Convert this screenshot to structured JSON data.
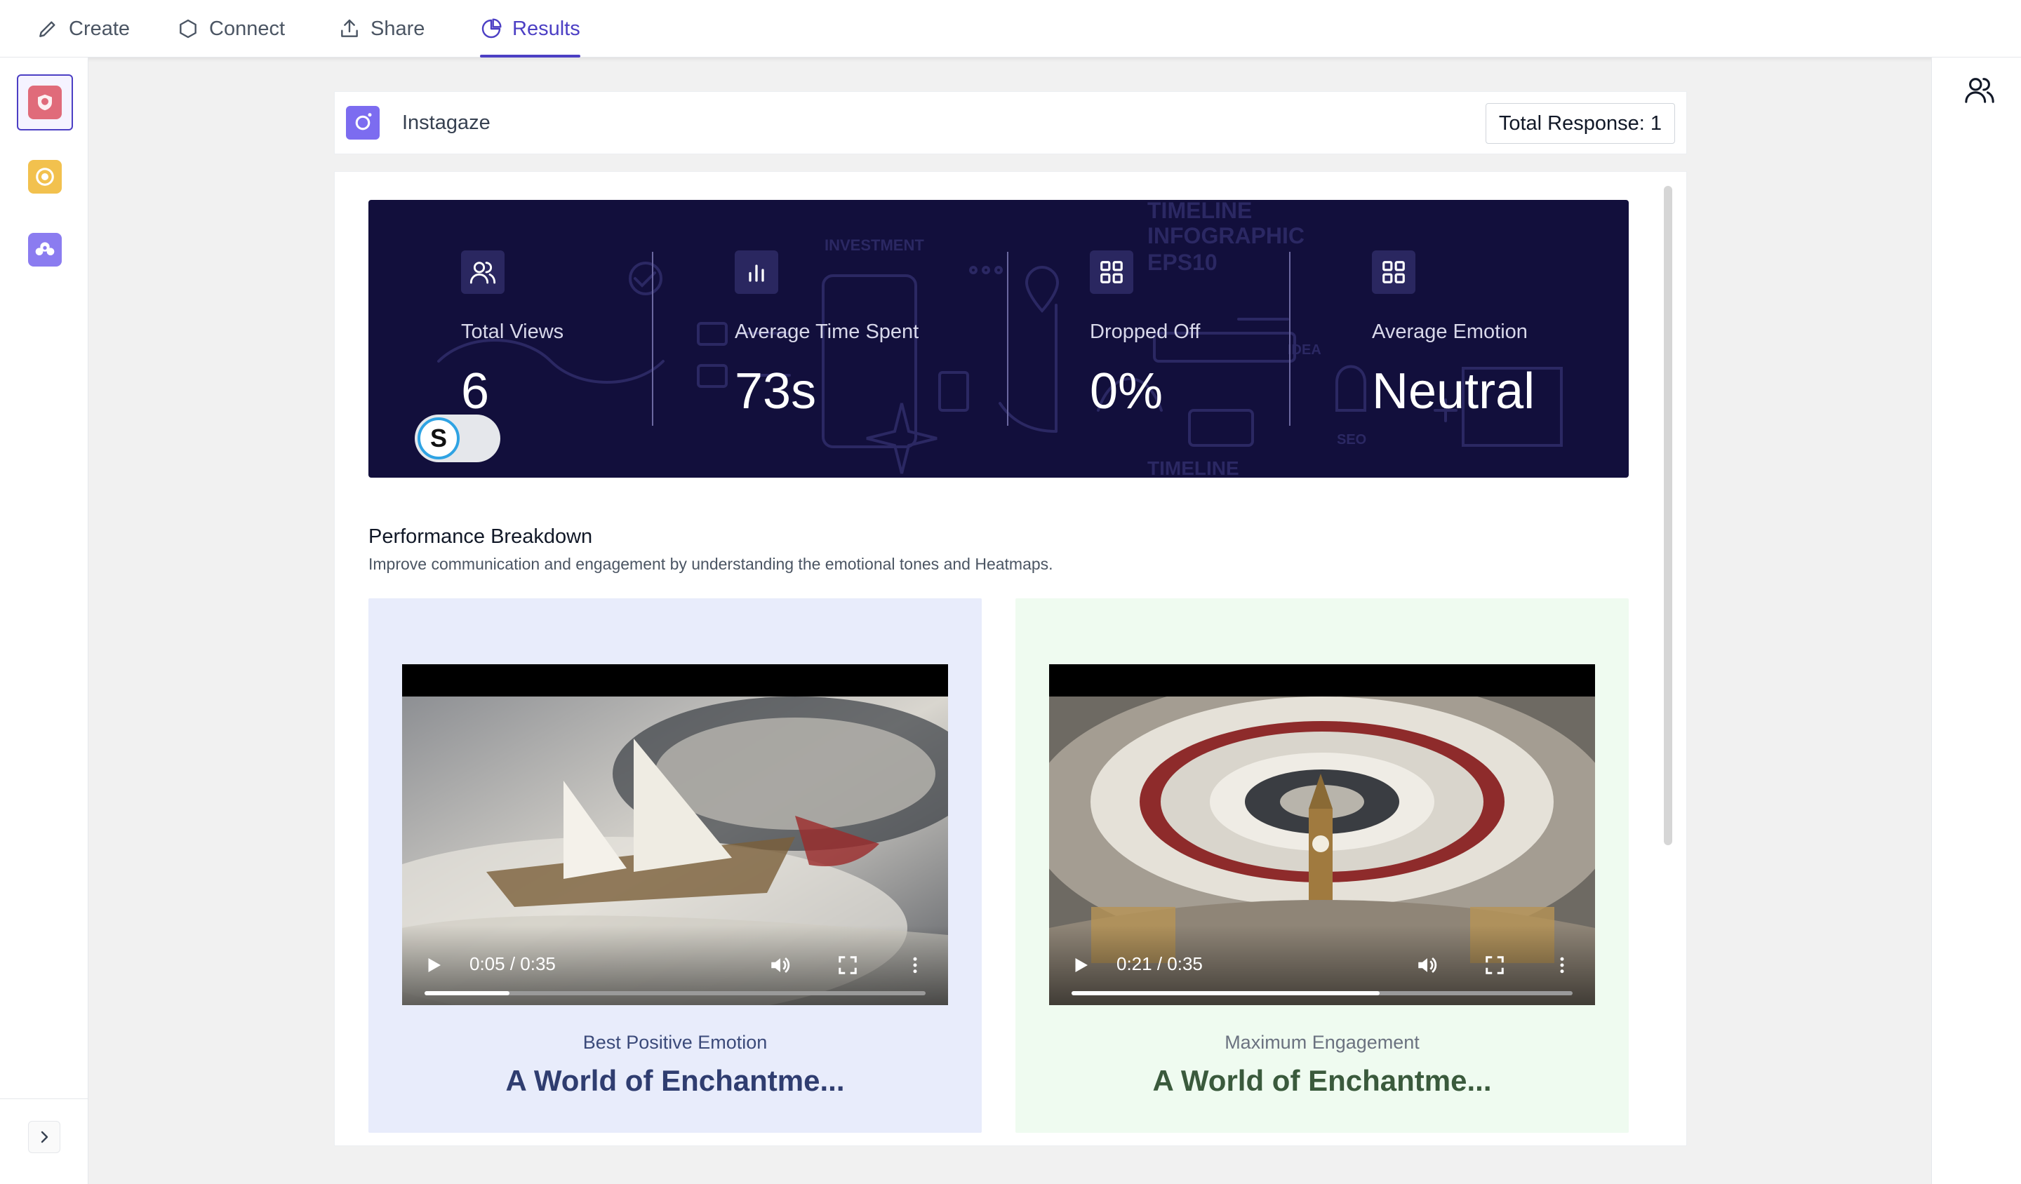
{
  "nav": {
    "tabs": [
      {
        "label": "Create",
        "icon": "pencil-icon"
      },
      {
        "label": "Connect",
        "icon": "hexagon-icon"
      },
      {
        "label": "Share",
        "icon": "share-icon"
      },
      {
        "label": "Results",
        "icon": "pie-chart-icon",
        "active": true
      }
    ]
  },
  "sidebar": {
    "items": [
      {
        "icon": "instagaze-app-icon",
        "color": "#e06b7a",
        "active": true
      },
      {
        "icon": "target-app-icon",
        "color": "#f2c14e"
      },
      {
        "icon": "cloud-app-icon",
        "color": "#8b7cf0"
      }
    ]
  },
  "header": {
    "app_name": "Instagaze",
    "total_response": "Total Response: 1"
  },
  "stats": [
    {
      "label": "Total Views",
      "value": "6",
      "icon": "users-icon"
    },
    {
      "label": "Average Time Spent",
      "value": "73s",
      "icon": "bar-chart-icon"
    },
    {
      "label": "Dropped Off",
      "value": "0%",
      "icon": "grid-icon"
    },
    {
      "label": "Average Emotion",
      "value": "Neutral",
      "icon": "grid-icon"
    }
  ],
  "banner_watermark": {
    "line1": "INVESTMENT",
    "line2": "TIMELINE",
    "line3": "INFOGRAPHIC",
    "line4": "EPS10",
    "line5": "IDEA",
    "line6": "SEO",
    "line7": "TIMELINE"
  },
  "toggle_letter": "S",
  "performance": {
    "title": "Performance Breakdown",
    "subtitle": "Improve communication and engagement by understanding the emotional tones and Heatmaps."
  },
  "videos": [
    {
      "time": "0:05 / 0:35",
      "progress": 0.17,
      "label": "Best Positive Emotion",
      "title": "A World of Enchantme..."
    },
    {
      "time": "0:21 / 0:35",
      "progress": 0.615,
      "label": "Maximum Engagement",
      "title": "A World of Enchantme..."
    }
  ],
  "colors": {
    "accent": "#4c3fc4",
    "banner_bg": "#120f3c",
    "card_blue": "#e8ecfb",
    "card_green": "#effbf0"
  }
}
